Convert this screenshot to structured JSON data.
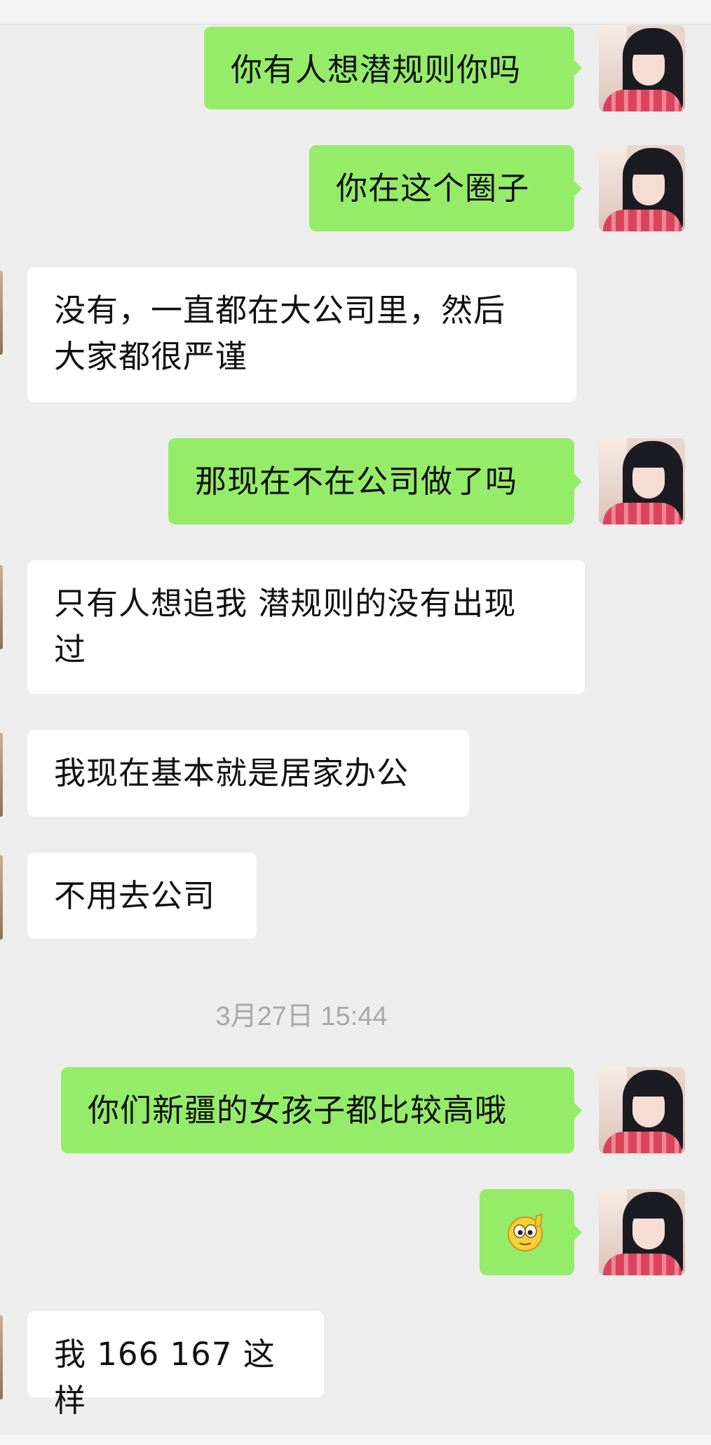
{
  "chat": {
    "messages": [
      {
        "id": "m1",
        "sender": "me",
        "text": "你有人想潜规则你吗"
      },
      {
        "id": "m2",
        "sender": "me",
        "text": "你在这个圈子"
      },
      {
        "id": "m3",
        "sender": "them",
        "lines": [
          "没有，一直都在大公司里，然后",
          "大家都很严谨"
        ]
      },
      {
        "id": "m4",
        "sender": "me",
        "text": "那现在不在公司做了吗"
      },
      {
        "id": "m5",
        "sender": "them",
        "lines": [
          "只有人想追我 潜规则的没有出现",
          "过"
        ]
      },
      {
        "id": "m6",
        "sender": "them",
        "text": "我现在基本就是居家办公"
      },
      {
        "id": "m7",
        "sender": "them",
        "text": "不用去公司"
      },
      {
        "id": "m8",
        "sender": "me",
        "text": "你们新疆的女孩子都比较高哦"
      },
      {
        "id": "m9",
        "sender": "me",
        "emoji": "salute-emoji"
      },
      {
        "id": "m10",
        "sender": "them",
        "text": "我 166 167 这样"
      }
    ],
    "timestamp": "3月27日 15:44"
  },
  "colors": {
    "background": "#ededed",
    "my_bubble": "#95ec69",
    "their_bubble": "#ffffff",
    "timestamp_text": "#a8a8a8"
  },
  "icons": {
    "my_avatar": "girl-avatar",
    "emoji": "salute-emoji"
  }
}
